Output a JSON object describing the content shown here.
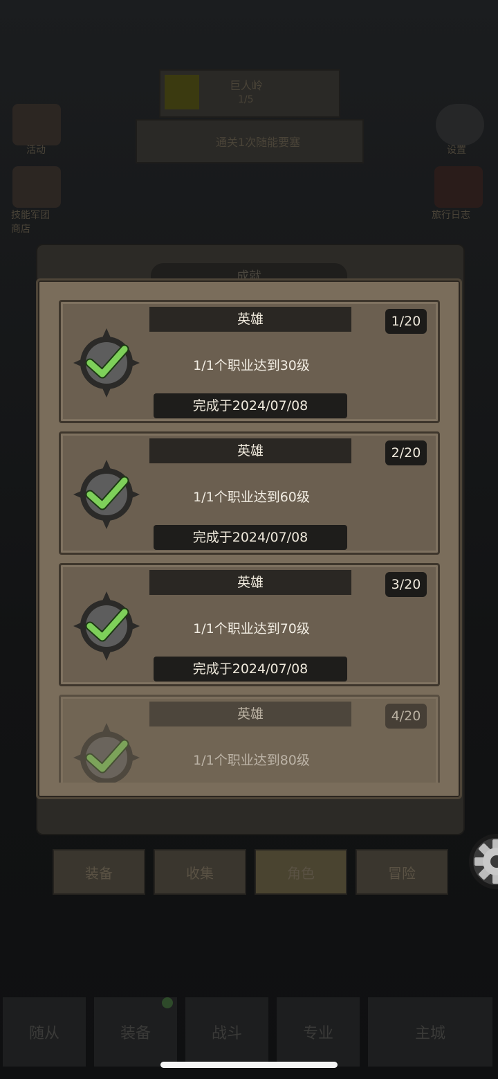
{
  "background": {
    "stage_name": "巨人岭",
    "stage_progress": "1/5",
    "quest_text": "通关1次随能要塞",
    "left_icons": [
      "活动",
      "技能军团\n商店"
    ],
    "right_icons": [
      "设置",
      "旅行日志"
    ],
    "panel_title": "成就",
    "tabs": [
      "装备",
      "收集",
      "角色",
      "冒险"
    ],
    "bottom_nav": [
      "随从",
      "装备",
      "战斗",
      "专业",
      "主城"
    ]
  },
  "achievements": [
    {
      "title": "英雄",
      "count": "1/20",
      "desc": "1/1个职业达到30级",
      "date": "完成于2024/07/08"
    },
    {
      "title": "英雄",
      "count": "2/20",
      "desc": "1/1个职业达到60级",
      "date": "完成于2024/07/08"
    },
    {
      "title": "英雄",
      "count": "3/20",
      "desc": "1/1个职业达到70级",
      "date": "完成于2024/07/08"
    },
    {
      "title": "英雄",
      "count": "4/20",
      "desc": "1/1个职业达到80级",
      "date": ""
    }
  ],
  "colors": {
    "check": "#7ed05a",
    "badge_ring": "#2b2a28",
    "panel": "#7a6d5b"
  }
}
